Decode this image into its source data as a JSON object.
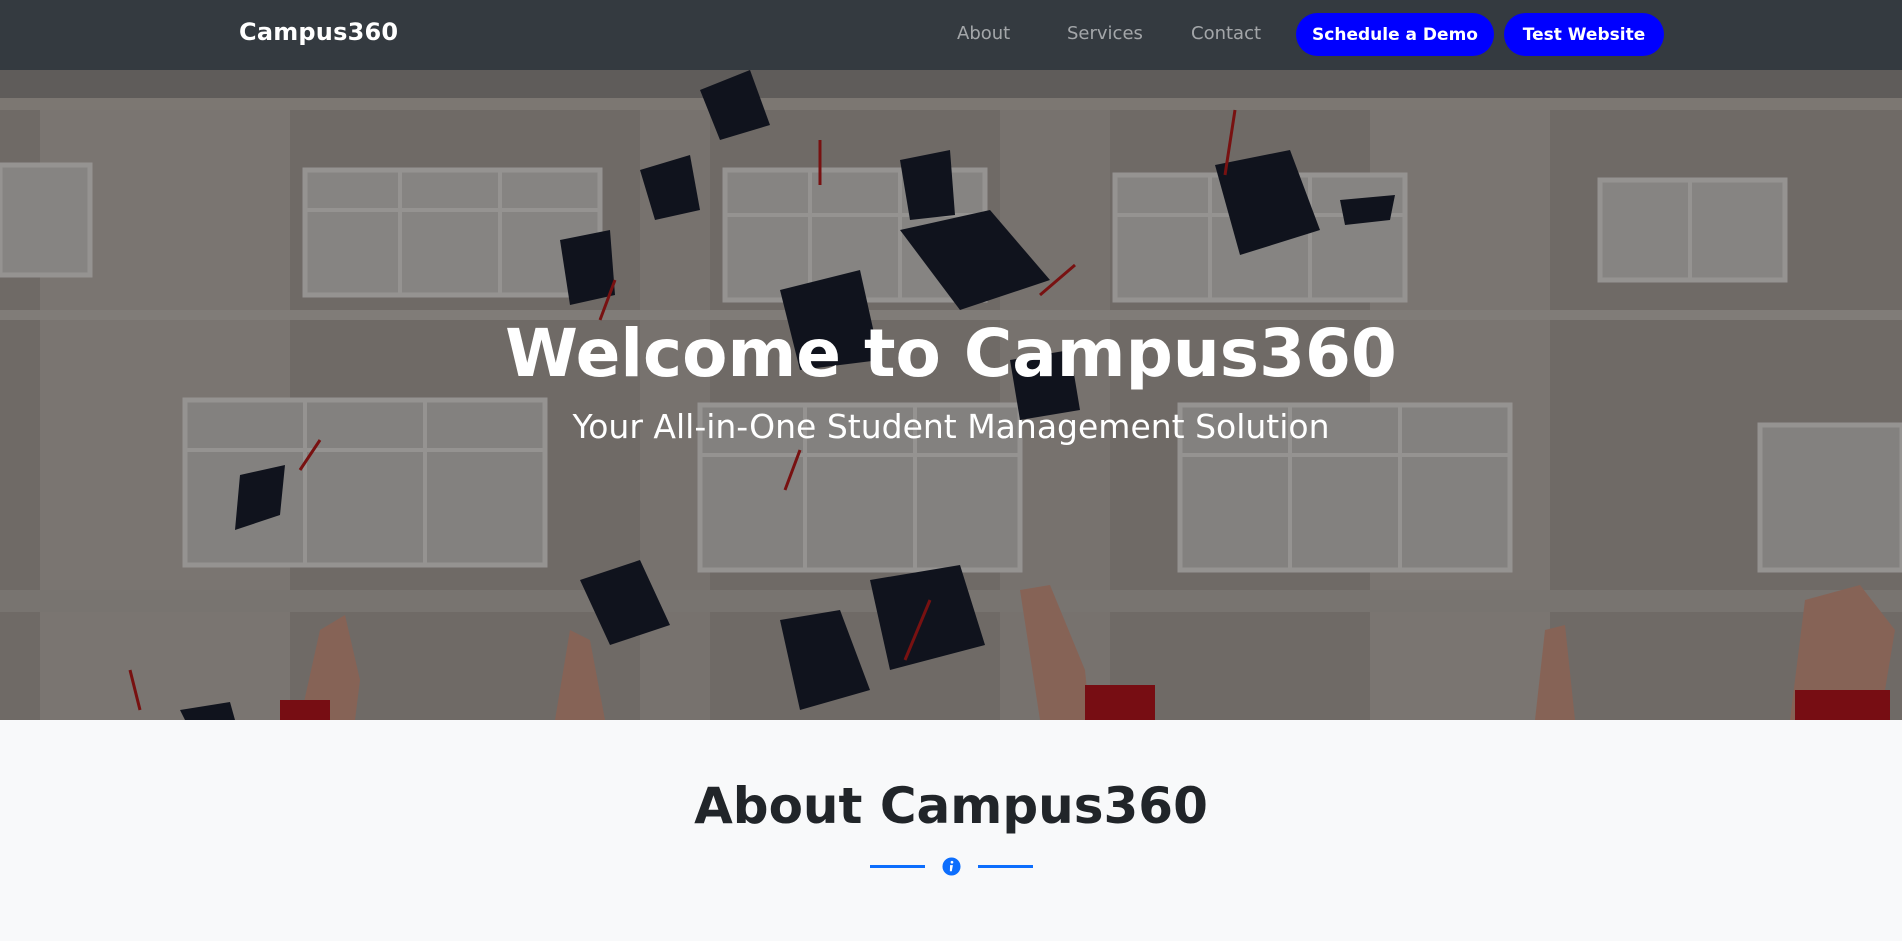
{
  "navbar": {
    "brand": "Campus360",
    "links": [
      "About",
      "Services",
      "Contact"
    ],
    "buttons": {
      "demo": "Schedule a Demo",
      "test": "Test Website"
    },
    "button_color": "#0000ff",
    "background": "#343a40"
  },
  "hero": {
    "title": "Welcome to Campus360",
    "subtitle": "Your All-in-One Student Management Solution",
    "background_image": "graduation-caps-thrown-in-front-of-university-building"
  },
  "about": {
    "title": "About Campus360",
    "divider_icon": "info-icon",
    "accent_color": "#0d6efd"
  }
}
